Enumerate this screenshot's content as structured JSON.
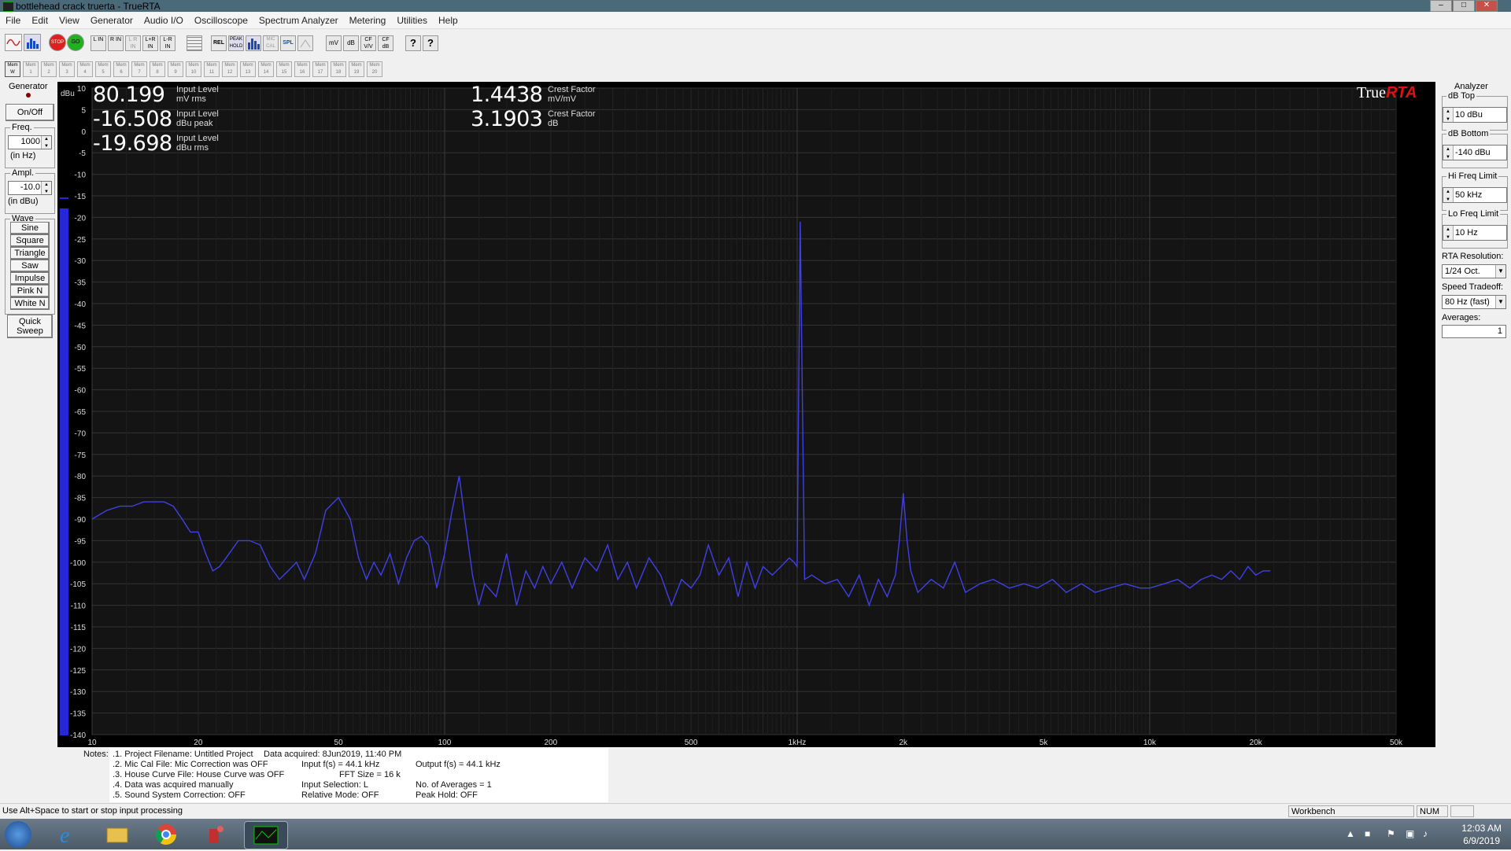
{
  "window": {
    "title": "bottlehead crack truerta"
  },
  "titlebar": {
    "title": "bottlehead crack truerta - TrueRTA"
  },
  "menu": [
    "File",
    "Edit",
    "View",
    "Generator",
    "Audio I/O",
    "Oscilloscope",
    "Spectrum Analyzer",
    "Metering",
    "Utilities",
    "Help"
  ],
  "toolbar": {
    "buttons": [
      {
        "label": "",
        "icon": "waveform-icon"
      },
      {
        "label": "",
        "icon": "rta-bars-icon"
      },
      {
        "label": "STOP",
        "icon": "stop-icon"
      },
      {
        "label": "GO",
        "icon": "go-icon"
      },
      {
        "label": "L IN",
        "icon": "left-input-icon"
      },
      {
        "label": "R IN",
        "icon": "right-input-icon"
      },
      {
        "label": "L R IN",
        "icon": "stereo-input-icon"
      },
      {
        "label": "L+R IN",
        "icon": "sum-input-icon"
      },
      {
        "label": "L-R IN",
        "icon": "diff-input-icon"
      },
      {
        "label": "",
        "icon": "grid-icon"
      },
      {
        "label": "REL",
        "icon": "relative-icon"
      },
      {
        "label": "PEAK HOLD",
        "icon": "peak-hold-icon"
      },
      {
        "label": "",
        "icon": "bars-icon"
      },
      {
        "label": "MIC CAL",
        "icon": "mic-cal-icon"
      },
      {
        "label": "SPL",
        "icon": "spl-icon"
      },
      {
        "label": "",
        "icon": "sweep-icon"
      },
      {
        "label": "mV",
        "icon": "mv-icon"
      },
      {
        "label": "dB",
        "icon": "db-icon"
      },
      {
        "label": "CF V/V",
        "icon": "cf-vv-icon"
      },
      {
        "label": "CF dB",
        "icon": "cf-db-icon"
      },
      {
        "label": "?",
        "icon": "help-icon"
      },
      {
        "label": "?",
        "icon": "context-help-icon"
      }
    ],
    "memories": [
      "Mem W",
      "Mem 1",
      "Mem 2",
      "Mem 3",
      "Mem 4",
      "Mem 5",
      "Mem 6",
      "Mem 7",
      "Mem 8",
      "Mem 9",
      "Mem 10",
      "Mem 11",
      "Mem 12",
      "Mem 13",
      "Mem 14",
      "Mem 15",
      "Mem 16",
      "Mem 17",
      "Mem 18",
      "Mem 19",
      "Mem 20"
    ]
  },
  "generator": {
    "title": "Generator",
    "onoff": "On/Off",
    "freq_label": "Freq.",
    "freq_value": "1000",
    "freq_unit": "(in Hz)",
    "ampl_label": "Ampl.",
    "ampl_value": "-10.0",
    "ampl_unit": "(in dBu)",
    "wave_label": "Wave",
    "waves": [
      "Sine",
      "Square",
      "Triangle",
      "Saw",
      "Impulse",
      "Pink N",
      "White N"
    ],
    "quick_sweep": "Quick Sweep"
  },
  "readouts": {
    "level1": {
      "value": "80.199",
      "l1": "Input Level",
      "l2": "mV rms"
    },
    "level2": {
      "value": "-16.508",
      "l1": "Input Level",
      "l2": "dBu peak"
    },
    "level3": {
      "value": "-19.698",
      "l1": "Input Level",
      "l2": "dBu rms"
    },
    "crest1": {
      "value": "1.4438",
      "l1": "Crest Factor",
      "l2": "mV/mV"
    },
    "crest2": {
      "value": "3.1903",
      "l1": "Crest Factor",
      "l2": "dB"
    }
  },
  "logo": {
    "true": "True",
    "rta": "RTA"
  },
  "analyzer": {
    "title": "Analyzer",
    "db_top_label": "dB Top",
    "db_top": "10 dBu",
    "db_bottom_label": "dB Bottom",
    "db_bottom": "-140 dBu",
    "hi_label": "Hi Freq Limit",
    "hi": "50 kHz",
    "lo_label": "Lo Freq Limit",
    "lo": "10 Hz",
    "res_label": "RTA Resolution:",
    "res": "1/24 Oct.",
    "speed_label": "Speed Tradeoff:",
    "speed": "80 Hz (fast)",
    "avg_label": "Averages:",
    "avg": "1"
  },
  "chart_data": {
    "type": "line",
    "title": "",
    "xlabel": "",
    "ylabel": "dBu",
    "xscale": "log",
    "xlim": [
      10,
      50000
    ],
    "ylim": [
      -140,
      10
    ],
    "grid": true,
    "y_ticks": [
      10,
      5,
      0,
      -5,
      -10,
      -15,
      -20,
      -25,
      -30,
      -35,
      -40,
      -45,
      -50,
      -55,
      -60,
      -65,
      -70,
      -75,
      -80,
      -85,
      -90,
      -95,
      -100,
      -105,
      -110,
      -115,
      -120,
      -125,
      -130,
      -135,
      -140
    ],
    "x_ticks": [
      {
        "v": 10,
        "t": "10"
      },
      {
        "v": 20,
        "t": "20"
      },
      {
        "v": 50,
        "t": "50"
      },
      {
        "v": 100,
        "t": "100"
      },
      {
        "v": 200,
        "t": "200"
      },
      {
        "v": 500,
        "t": "500"
      },
      {
        "v": 1000,
        "t": "1kHz"
      },
      {
        "v": 2000,
        "t": "2k"
      },
      {
        "v": 5000,
        "t": "5k"
      },
      {
        "v": 10000,
        "t": "10k"
      },
      {
        "v": 20000,
        "t": "20k"
      },
      {
        "v": 50000,
        "t": "50k"
      }
    ],
    "color": "#4040e8",
    "series": [
      {
        "x": [
          10,
          11,
          12,
          13,
          14,
          15,
          16,
          17,
          18,
          19,
          20,
          21,
          22,
          23,
          24,
          26,
          28,
          30,
          32,
          34,
          36,
          38,
          40,
          43,
          46,
          50,
          54,
          57,
          60,
          63,
          66,
          70,
          74,
          78,
          82,
          86,
          90,
          95,
          100,
          105,
          110,
          115,
          120,
          125,
          130,
          140,
          150,
          160,
          170,
          180,
          190,
          200,
          215,
          230,
          250,
          270,
          290,
          310,
          330,
          350,
          380,
          410,
          440,
          470,
          500,
          530,
          560,
          600,
          640,
          680,
          720,
          760,
          800,
          850,
          900,
          950,
          980,
          1000,
          1020,
          1050,
          1100,
          1200,
          1300,
          1400,
          1500,
          1600,
          1700,
          1800,
          1900,
          1950,
          2000,
          2050,
          2100,
          2200,
          2400,
          2600,
          2800,
          3000,
          3300,
          3600,
          4000,
          4400,
          4800,
          5300,
          5800,
          6400,
          7000,
          7700,
          8500,
          9400,
          10000,
          11000,
          12000,
          13000,
          14000,
          15000,
          16000,
          17000,
          18000,
          19000,
          20000,
          21000,
          22000
        ],
        "y": [
          -90,
          -88,
          -87,
          -87,
          -86,
          -86,
          -86,
          -87,
          -90,
          -93,
          -93,
          -98,
          -102,
          -101,
          -99,
          -95,
          -95,
          -96,
          -101,
          -104,
          -102,
          -100,
          -104,
          -98,
          -88,
          -85,
          -90,
          -99,
          -104,
          -100,
          -103,
          -98,
          -105,
          -99,
          -95,
          -94,
          -96,
          -106,
          -98,
          -88,
          -80,
          -92,
          -103,
          -110,
          -105,
          -108,
          -98,
          -110,
          -102,
          -106,
          -101,
          -105,
          -100,
          -106,
          -99,
          -102,
          -96,
          -104,
          -100,
          -106,
          -99,
          -103,
          -110,
          -104,
          -106,
          -103,
          -96,
          -103,
          -99,
          -108,
          -100,
          -106,
          -101,
          -103,
          -101,
          -99,
          -100,
          -101,
          -21,
          -104,
          -103,
          -105,
          -104,
          -108,
          -103,
          -110,
          -104,
          -108,
          -103,
          -95,
          -84,
          -95,
          -102,
          -107,
          -104,
          -106,
          -100,
          -107,
          -105,
          -104,
          -106,
          -105,
          -106,
          -104,
          -107,
          -105,
          -107,
          -106,
          -105,
          -106,
          -106,
          -105,
          -104,
          -106,
          -104,
          -103,
          -104,
          -102,
          -104,
          -101,
          -103,
          -102,
          -102
        ]
      }
    ]
  },
  "notes": {
    "label": "Notes:",
    "lines": [
      ".1. Project Filename: Untitled Project",
      ".2. Mic Cal File: Mic Correction was OFF",
      ".3. House Curve File: House Curve was OFF",
      ".4. Data was acquired manually",
      ".5. Sound System Correction: OFF"
    ],
    "acq": "Data acquired: 8Jun2019, 11:40 PM",
    "input_fs": "Input f(s) = 44.1 kHz",
    "fft": "FFT Size = 16 k",
    "input_sel": "Input Selection: L",
    "rel": "Relative Mode:  OFF",
    "output_fs": "Output f(s) = 44.1 kHz",
    "averages": "No. of Averages = 1",
    "peak": "Peak Hold: OFF"
  },
  "status": {
    "hint": "Use Alt+Space to start or stop input processing",
    "mode": "Workbench",
    "num": "NUM"
  },
  "taskbar": {
    "time": "12:03 AM",
    "date": "6/9/2019"
  }
}
